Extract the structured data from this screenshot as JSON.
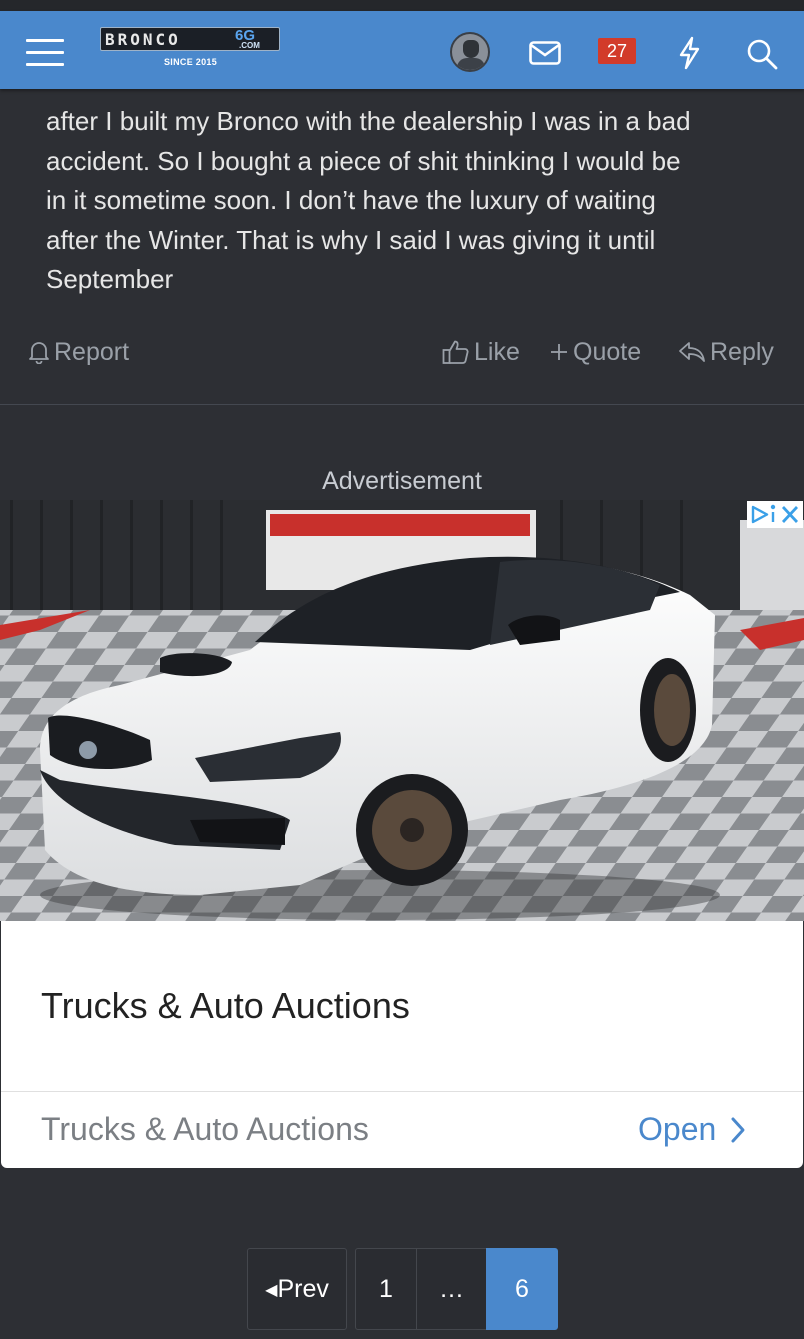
{
  "header": {
    "logo_word": "BRONCO",
    "logo_suffix": "6G",
    "logo_com": ".COM",
    "logo_since": "SINCE 2015",
    "alerts_count": "27",
    "icons": [
      "menu-icon",
      "avatar",
      "mail-icon",
      "lightning-icon",
      "search-icon"
    ]
  },
  "post": {
    "lines": [
      "after I built my Bronco with the dealership I was in a bad",
      "accident. So I bought a piece of shit thinking I would be",
      "in it sometime soon. I don’t have the luxury of waiting",
      "after the Winter. That is why I said I was giving it until",
      "September"
    ],
    "actions": {
      "report": "Report",
      "like": "Like",
      "quote": "Quote",
      "reply": "Reply"
    }
  },
  "ad": {
    "label": "Advertisement",
    "title": "Trucks & Auto Auctions",
    "subtitle": "Trucks & Auto Auctions",
    "cta": "Open"
  },
  "pagination": {
    "prev": "Prev",
    "pages": [
      "1",
      "…",
      "6"
    ],
    "current": "6"
  },
  "colors": {
    "header_bg": "#4a88cc",
    "page_bg": "#2d2f34",
    "badge_red": "#d23b2a",
    "accent_blue": "#4a88cc"
  }
}
